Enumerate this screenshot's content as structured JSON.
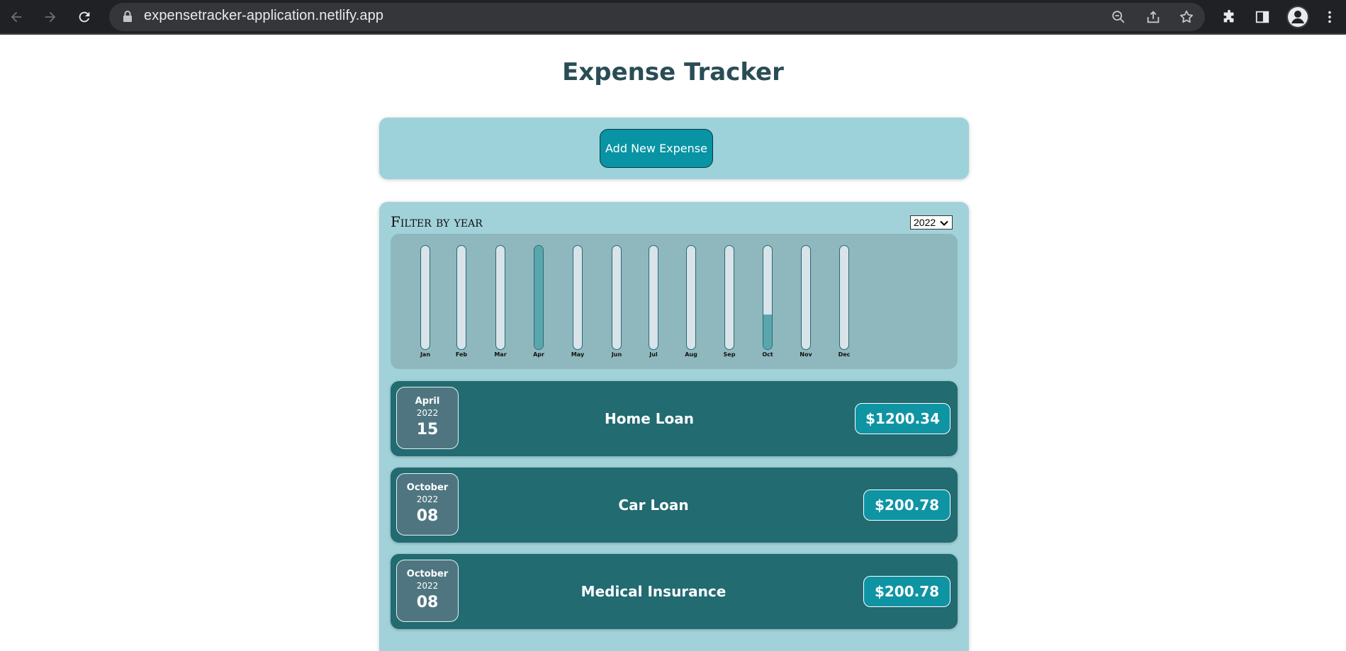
{
  "browser": {
    "url": "expensetracker-application.netlify.app",
    "icons": [
      "back-icon",
      "forward-icon",
      "reload-icon",
      "lock-icon",
      "zoom-icon",
      "share-icon",
      "bookmark-star-icon",
      "extensions-icon",
      "side-panel-icon",
      "profile-icon",
      "menu-icon"
    ]
  },
  "page": {
    "title": "Expense Tracker",
    "add_button_label": "Add New Expense",
    "filter_label": "Filter by year",
    "selected_year": "2022"
  },
  "chart_data": {
    "type": "bar",
    "categories": [
      "Jan",
      "Feb",
      "Mar",
      "Apr",
      "May",
      "Jun",
      "Jul",
      "Aug",
      "Sep",
      "Oct",
      "Nov",
      "Dec"
    ],
    "values": [
      0,
      0,
      0,
      1200.34,
      0,
      0,
      0,
      0,
      0,
      401.56,
      0,
      0
    ],
    "ylim": [
      0,
      1200.34
    ]
  },
  "expenses": [
    {
      "month": "April",
      "year": "2022",
      "day": "15",
      "title": "Home Loan",
      "amount": "$1200.34"
    },
    {
      "month": "October",
      "year": "2022",
      "day": "08",
      "title": "Car Loan",
      "amount": "$200.78"
    },
    {
      "month": "October",
      "year": "2022",
      "day": "08",
      "title": "Medical Insurance",
      "amount": "$200.78"
    }
  ],
  "colors": {
    "title": "#2a4d55",
    "panel": "#9dd2da",
    "button": "#0894a4",
    "item": "#216b71",
    "bar_fill": "#59a6ad"
  }
}
